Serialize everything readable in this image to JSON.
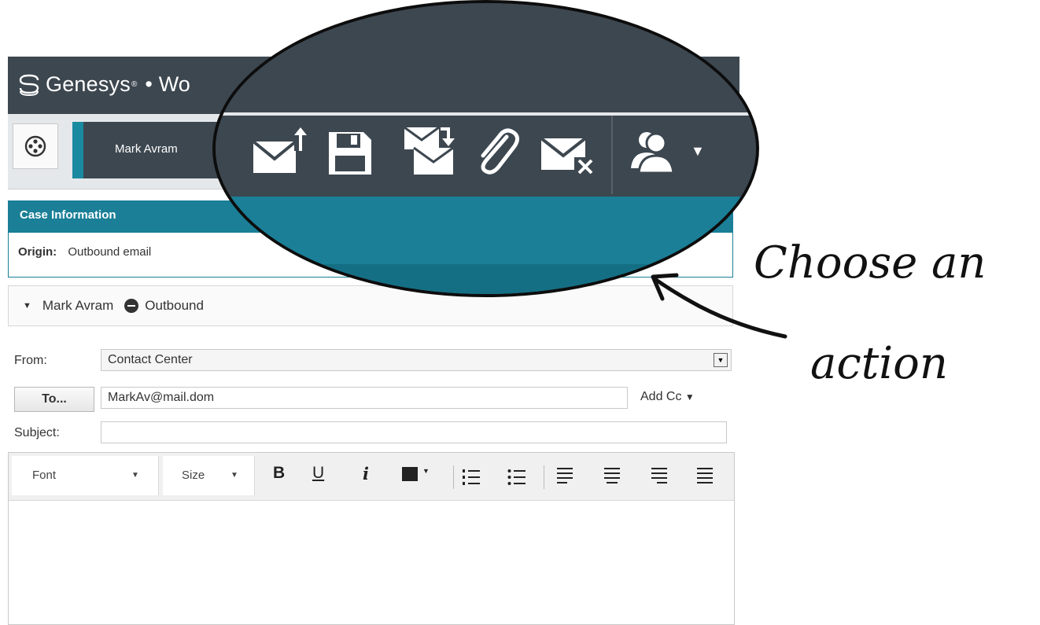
{
  "app": {
    "brand": "Genesys",
    "brand_mark": "®",
    "separator": "•",
    "product": "Wo"
  },
  "toolbar": {
    "party_name": "Mark Avram"
  },
  "case_info": {
    "header": "Case Information",
    "origin_label": "Origin:",
    "origin_value": "Outbound email"
  },
  "interaction": {
    "contact": "Mark Avram",
    "direction": "Outbound"
  },
  "email": {
    "from_label": "From:",
    "from_value": "Contact Center",
    "to_button": "To...",
    "to_value": "MarkAv@mail.dom",
    "add_cc": "Add Cc",
    "subject_label": "Subject:",
    "subject_value": ""
  },
  "editor": {
    "font_label": "Font",
    "size_label": "Size",
    "bold": "B",
    "underline": "U",
    "italic": "i"
  },
  "magnifier_actions": [
    "send-icon",
    "save-icon",
    "transfer-icon",
    "attach-icon",
    "delete-icon",
    "party-action-icon"
  ],
  "annotation": {
    "line1": "Choose an",
    "line2": "action"
  },
  "colors": {
    "titlebar": "#3d4750",
    "accent_teal": "#1a7f97",
    "toolbar_bg": "#e5e8ea"
  }
}
